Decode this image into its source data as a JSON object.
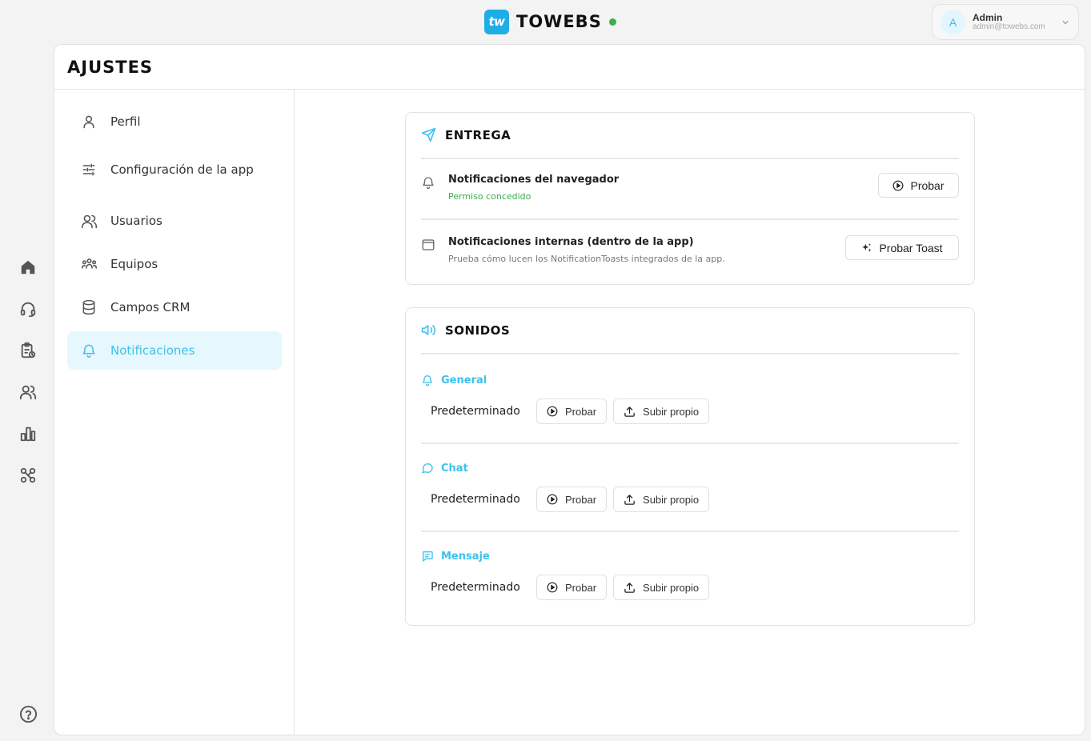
{
  "brand": {
    "logo_text": "tw",
    "name": "TOWEBS",
    "status_color": "#3aae4c"
  },
  "user": {
    "initial": "A",
    "name": "Admin",
    "email": "admin@towebs.com"
  },
  "rail": [
    "home-icon",
    "headset-icon",
    "clipboard-icon",
    "users-icon",
    "chart-icon",
    "integrations-icon",
    "help-icon"
  ],
  "page": {
    "title": "AJUSTES"
  },
  "nav": {
    "items": [
      {
        "label": "Perfil",
        "icon": "user-icon"
      },
      {
        "label": "Configuración de la app",
        "icon": "sliders-icon"
      },
      {
        "label": "Usuarios",
        "icon": "users-icon"
      },
      {
        "label": "Equipos",
        "icon": "teams-icon"
      },
      {
        "label": "Campos CRM",
        "icon": "database-icon"
      },
      {
        "label": "Notificaciones",
        "icon": "bell-icon",
        "active": true
      }
    ]
  },
  "delivery": {
    "title": "ENTREGA",
    "browser": {
      "title": "Notificaciones del navegador",
      "status": "Permiso concedido",
      "button": "Probar"
    },
    "internal": {
      "title": "Notificaciones internas (dentro de la app)",
      "desc": "Prueba cómo lucen los NotificationToasts integrados de la app.",
      "button": "Probar Toast"
    }
  },
  "sounds": {
    "title": "SONIDOS",
    "groups": [
      {
        "label": "General",
        "icon": "bell-icon",
        "value": "Predeterminado",
        "test": "Probar",
        "upload": "Subir propio"
      },
      {
        "label": "Chat",
        "icon": "chat-icon",
        "value": "Predeterminado",
        "test": "Probar",
        "upload": "Subir propio"
      },
      {
        "label": "Mensaje",
        "icon": "message-icon",
        "value": "Predeterminado",
        "test": "Probar",
        "upload": "Subir propio"
      }
    ]
  },
  "colors": {
    "accent": "#3cc1ee",
    "success": "#3aae4c",
    "logo_bg": "#1eaee6"
  }
}
